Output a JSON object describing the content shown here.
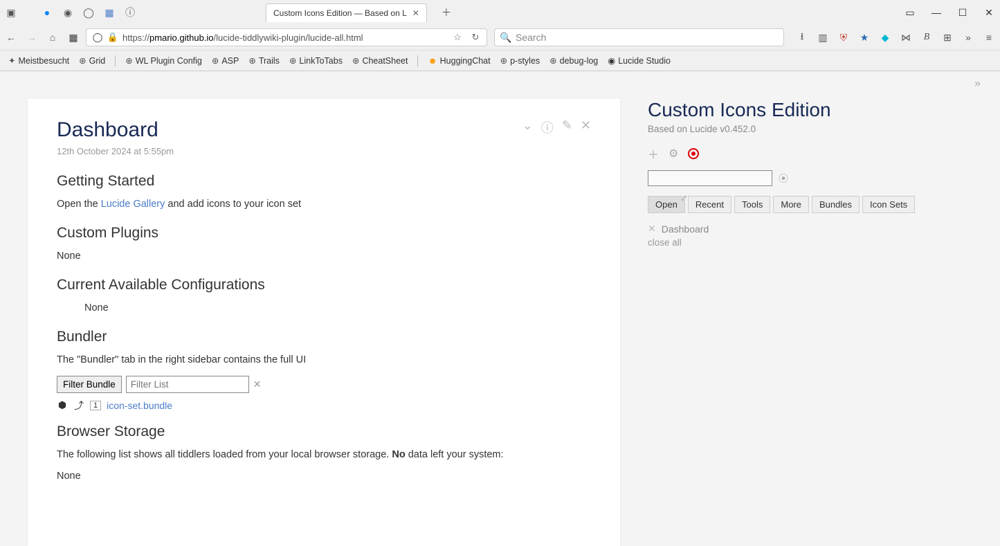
{
  "browser": {
    "tab_title": "Custom Icons Edition — Based on L",
    "url_prefix": "https://",
    "url_host": "pmario.github.io",
    "url_path": "/lucide-tiddlywiki-plugin/lucide-all.html",
    "search_placeholder": "Search",
    "bookmarks": [
      "Meistbesucht",
      "Grid",
      "WL Plugin Config",
      "ASP",
      "Trails",
      "LinkToTabs",
      "CheatSheet",
      "HuggingChat",
      "p-styles",
      "debug-log",
      "Lucide Studio"
    ]
  },
  "tiddler": {
    "title": "Dashboard",
    "date": "12th October 2024 at 5:55pm",
    "h_getting_started": "Getting Started",
    "p_open_pre": "Open the ",
    "link_gallery": "Lucide Gallery",
    "p_open_post": " and add icons to your icon set",
    "h_custom_plugins": "Custom Plugins",
    "none1": "None",
    "h_configs": "Current Available Configurations",
    "none2": "None",
    "h_bundler": "Bundler",
    "p_bundler": "The \"Bundler\" tab in the right sidebar contains the full UI",
    "filter_btn": "Filter Bundle",
    "filter_placeholder": "Filter List",
    "bundle_count": "1",
    "bundle_link": "icon-set.bundle",
    "h_storage": "Browser Storage",
    "p_storage_pre": "The following list shows all tiddlers loaded from your local browser storage. ",
    "p_storage_bold": "No",
    "p_storage_post": " data left your system:",
    "none3": "None"
  },
  "sidebar": {
    "title": "Custom Icons Edition",
    "subtitle": "Based on Lucide v0.452.0",
    "tabs": [
      "Open",
      "Recent",
      "Tools",
      "More",
      "Bundles",
      "Icon Sets"
    ],
    "open_item": "Dashboard",
    "close_all": "close all"
  }
}
